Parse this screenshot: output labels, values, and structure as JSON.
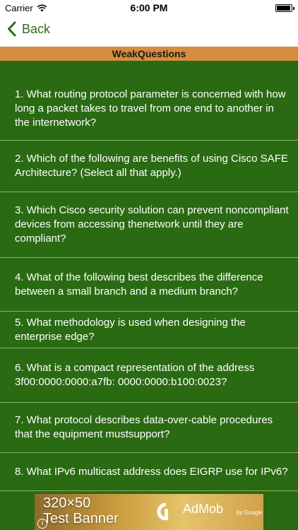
{
  "status_bar": {
    "carrier": "Carrier",
    "time": "6:00 PM"
  },
  "nav": {
    "back_label": "Back"
  },
  "title": "WeakQuestions",
  "questions": [
    "1. What routing protocol parameter is concerned with how long a packet takes to travel from one end to another in the internetwork?",
    "2. Which of the following are benefits of using Cisco SAFE Architecture? (Select all that apply.)",
    "3. Which Cisco security solution can prevent noncompliant devices from accessing thenetwork until they are compliant?",
    "4. What of the following best describes the difference between a small branch and a medium branch?",
    "5. What methodology is used when designing the enterprise edge?",
    "6. What is a compact representation of the address 3f00:0000:0000:a7fb: 0000:0000:b100:0023?",
    "7. What protocol describes data-over-cable procedures that the equipment mustsupport?",
    "8. What IPv6 multicast address does EIGRP use for IPv6?"
  ],
  "ad": {
    "line1": "320×50",
    "line2": "Test Banner",
    "brand": "AdMob",
    "by": "by Google",
    "info": "i"
  },
  "colors": {
    "accent": "#2e6d17",
    "list_bg": "#2a6a12",
    "title_bar": "#d68c3f"
  }
}
